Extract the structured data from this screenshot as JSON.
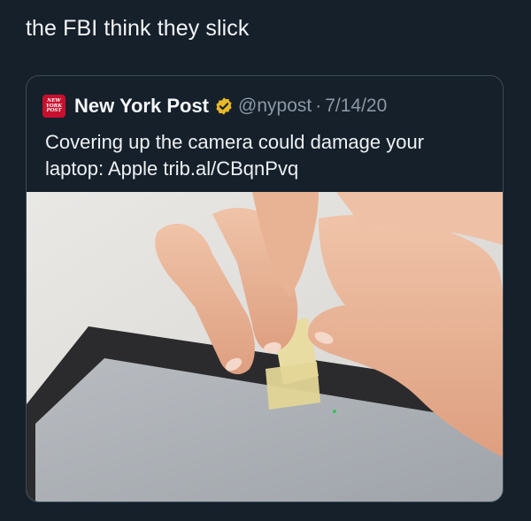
{
  "post": {
    "caption": "the FBI think they slick"
  },
  "quoted_tweet": {
    "logo_text": [
      "NEW",
      "YORK",
      "POST"
    ],
    "display_name": "New York Post",
    "handle": "@nypost",
    "separator": "·",
    "date": "7/14/20",
    "text": "Covering up the camera could damage your laptop: Apple trib.al/CBqnPvq",
    "verified_color": "#e8b827"
  },
  "media": {
    "description_icon": "photo-hands-taping-laptop-camera"
  }
}
